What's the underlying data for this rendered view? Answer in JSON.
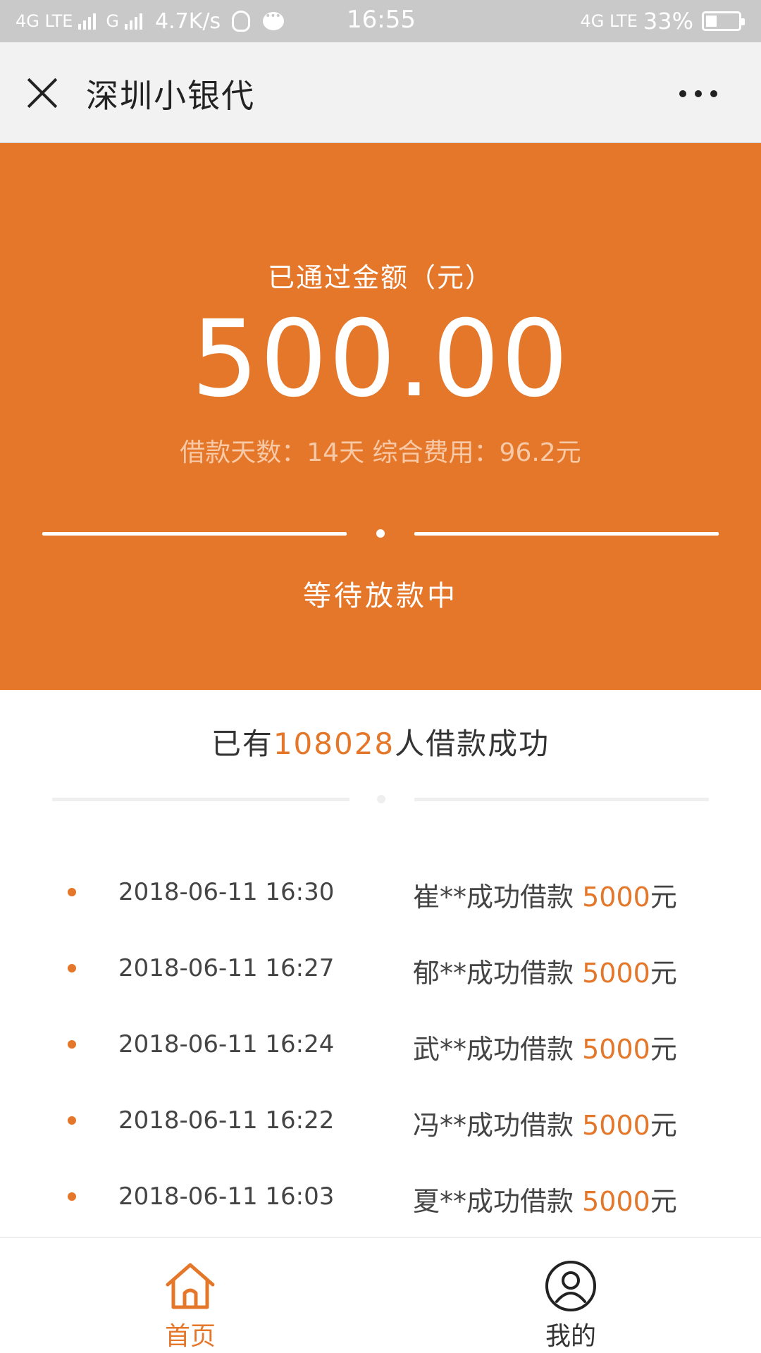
{
  "status_bar": {
    "network_left": "4G LTE",
    "network_mid": "G",
    "speed": "4.7K/s",
    "time": "16:55",
    "network_right": "4G LTE",
    "battery_percent": "33%",
    "battery_level": 0.33
  },
  "nav": {
    "title": "深圳小银代"
  },
  "hero": {
    "label": "已通过金额（元）",
    "amount": "500.00",
    "info": "借款天数：14天 综合费用：96.2元",
    "status": "等待放款中"
  },
  "counter": {
    "prefix": "已有",
    "count": "108028",
    "suffix": "人借款成功"
  },
  "records": [
    {
      "time": "2018-06-11 16:30",
      "name": "崔**成功借款 ",
      "amount": "5000",
      "unit": "元"
    },
    {
      "time": "2018-06-11 16:27",
      "name": "郁**成功借款 ",
      "amount": "5000",
      "unit": "元"
    },
    {
      "time": "2018-06-11 16:24",
      "name": "武**成功借款 ",
      "amount": "5000",
      "unit": "元"
    },
    {
      "time": "2018-06-11 16:22",
      "name": "冯**成功借款 ",
      "amount": "5000",
      "unit": "元"
    },
    {
      "time": "2018-06-11 16:03",
      "name": "夏**成功借款 ",
      "amount": "5000",
      "unit": "元"
    }
  ],
  "tabs": {
    "home": {
      "label": "首页",
      "icon": "home-icon"
    },
    "mine": {
      "label": "我的",
      "icon": "user-icon"
    }
  },
  "colors": {
    "accent": "#e5772a",
    "status_bar": "#c9c9c9",
    "nav_bg": "#f2f2f2"
  }
}
